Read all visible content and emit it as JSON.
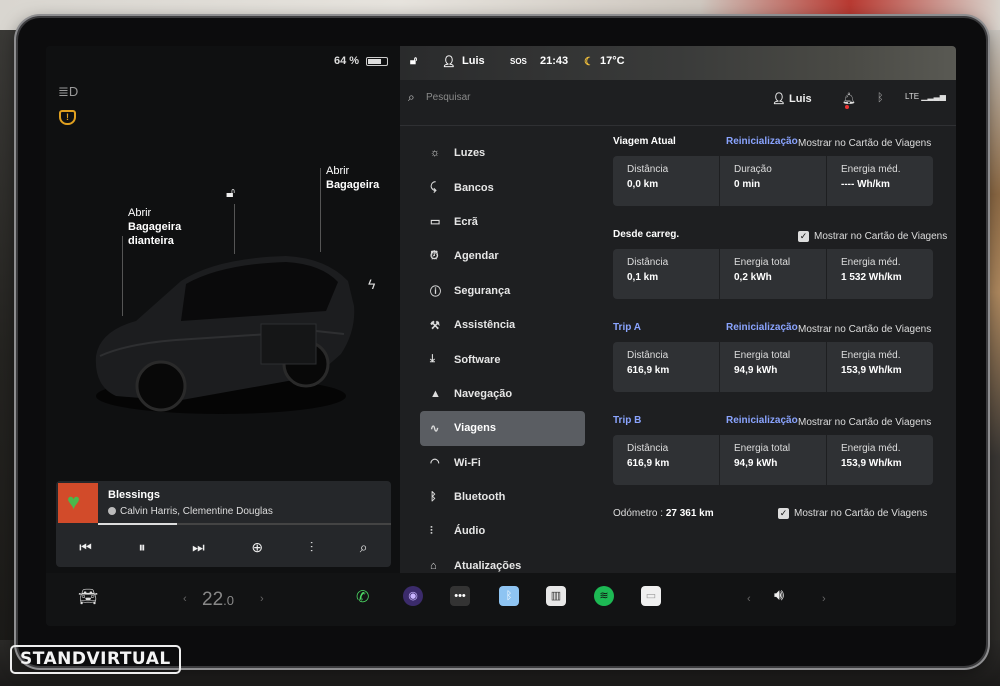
{
  "car_panel": {
    "battery_pct": "64 %",
    "frunk_label": [
      "Abrir",
      "Bagageira",
      "dianteira"
    ],
    "trunk_label": [
      "Abrir",
      "Bagageira"
    ]
  },
  "media": {
    "title": "Blessings",
    "artist": "Calvin Harris, Clementine Douglas",
    "progress_fraction": 0.27
  },
  "status_bar": {
    "user": "Luis",
    "sos": "SOS",
    "time": "21:43",
    "temp": "17°C"
  },
  "header": {
    "search_placeholder": "Pesquisar",
    "user": "Luis",
    "network": "LTE"
  },
  "menu": [
    {
      "icon": "sun-icon",
      "label": "Luzes"
    },
    {
      "icon": "seat-icon",
      "label": "Bancos"
    },
    {
      "icon": "screen-icon",
      "label": "Ecrã"
    },
    {
      "icon": "alarm-icon",
      "label": "Agendar"
    },
    {
      "icon": "warning-icon",
      "label": "Segurança"
    },
    {
      "icon": "wrench-icon",
      "label": "Assistência"
    },
    {
      "icon": "download-icon",
      "label": "Software"
    },
    {
      "icon": "navigation-icon",
      "label": "Navegação"
    },
    {
      "icon": "trips-icon",
      "label": "Viagens",
      "active": true
    },
    {
      "icon": "wifi-icon",
      "label": "Wi-Fi"
    },
    {
      "icon": "bluetooth-icon",
      "label": "Bluetooth"
    },
    {
      "icon": "audio-icon",
      "label": "Áudio"
    },
    {
      "icon": "updates-icon",
      "label": "Atualizações"
    }
  ],
  "trips": {
    "current": {
      "title": "Viagem Atual",
      "reset": "Reinicialização",
      "show": "Mostrar no Cartão de Viagens",
      "cells": [
        {
          "label": "Distância",
          "value": "0,0 km"
        },
        {
          "label": "Duração",
          "value": "0 min"
        },
        {
          "label": "Energia méd.",
          "value": "---- Wh/km"
        }
      ]
    },
    "since_charge": {
      "title": "Desde carreg.",
      "show": "Mostrar no Cartão de Viagens",
      "cells": [
        {
          "label": "Distância",
          "value": "0,1 km"
        },
        {
          "label": "Energia total",
          "value": "0,2 kWh"
        },
        {
          "label": "Energia méd.",
          "value": "1 532 Wh/km"
        }
      ]
    },
    "trip_a": {
      "title": "Trip A",
      "reset": "Reinicialização",
      "show": "Mostrar no Cartão de Viagens",
      "cells": [
        {
          "label": "Distância",
          "value": "616,9 km"
        },
        {
          "label": "Energia total",
          "value": "94,9 kWh"
        },
        {
          "label": "Energia méd.",
          "value": "153,9 Wh/km"
        }
      ]
    },
    "trip_b": {
      "title": "Trip B",
      "reset": "Reinicialização",
      "show": "Mostrar no Cartão de Viagens",
      "cells": [
        {
          "label": "Distância",
          "value": "616,9 km"
        },
        {
          "label": "Energia total",
          "value": "94,9 kWh"
        },
        {
          "label": "Energia méd.",
          "value": "153,9 Wh/km"
        }
      ]
    },
    "odometer_label": "Odómetro :",
    "odometer_value": "27 361 km",
    "odometer_show": "Mostrar no Cartão de Viagens"
  },
  "dock": {
    "temp_whole": "22",
    "temp_decimal": ".0"
  },
  "watermark": "STANDVIRTUAL"
}
